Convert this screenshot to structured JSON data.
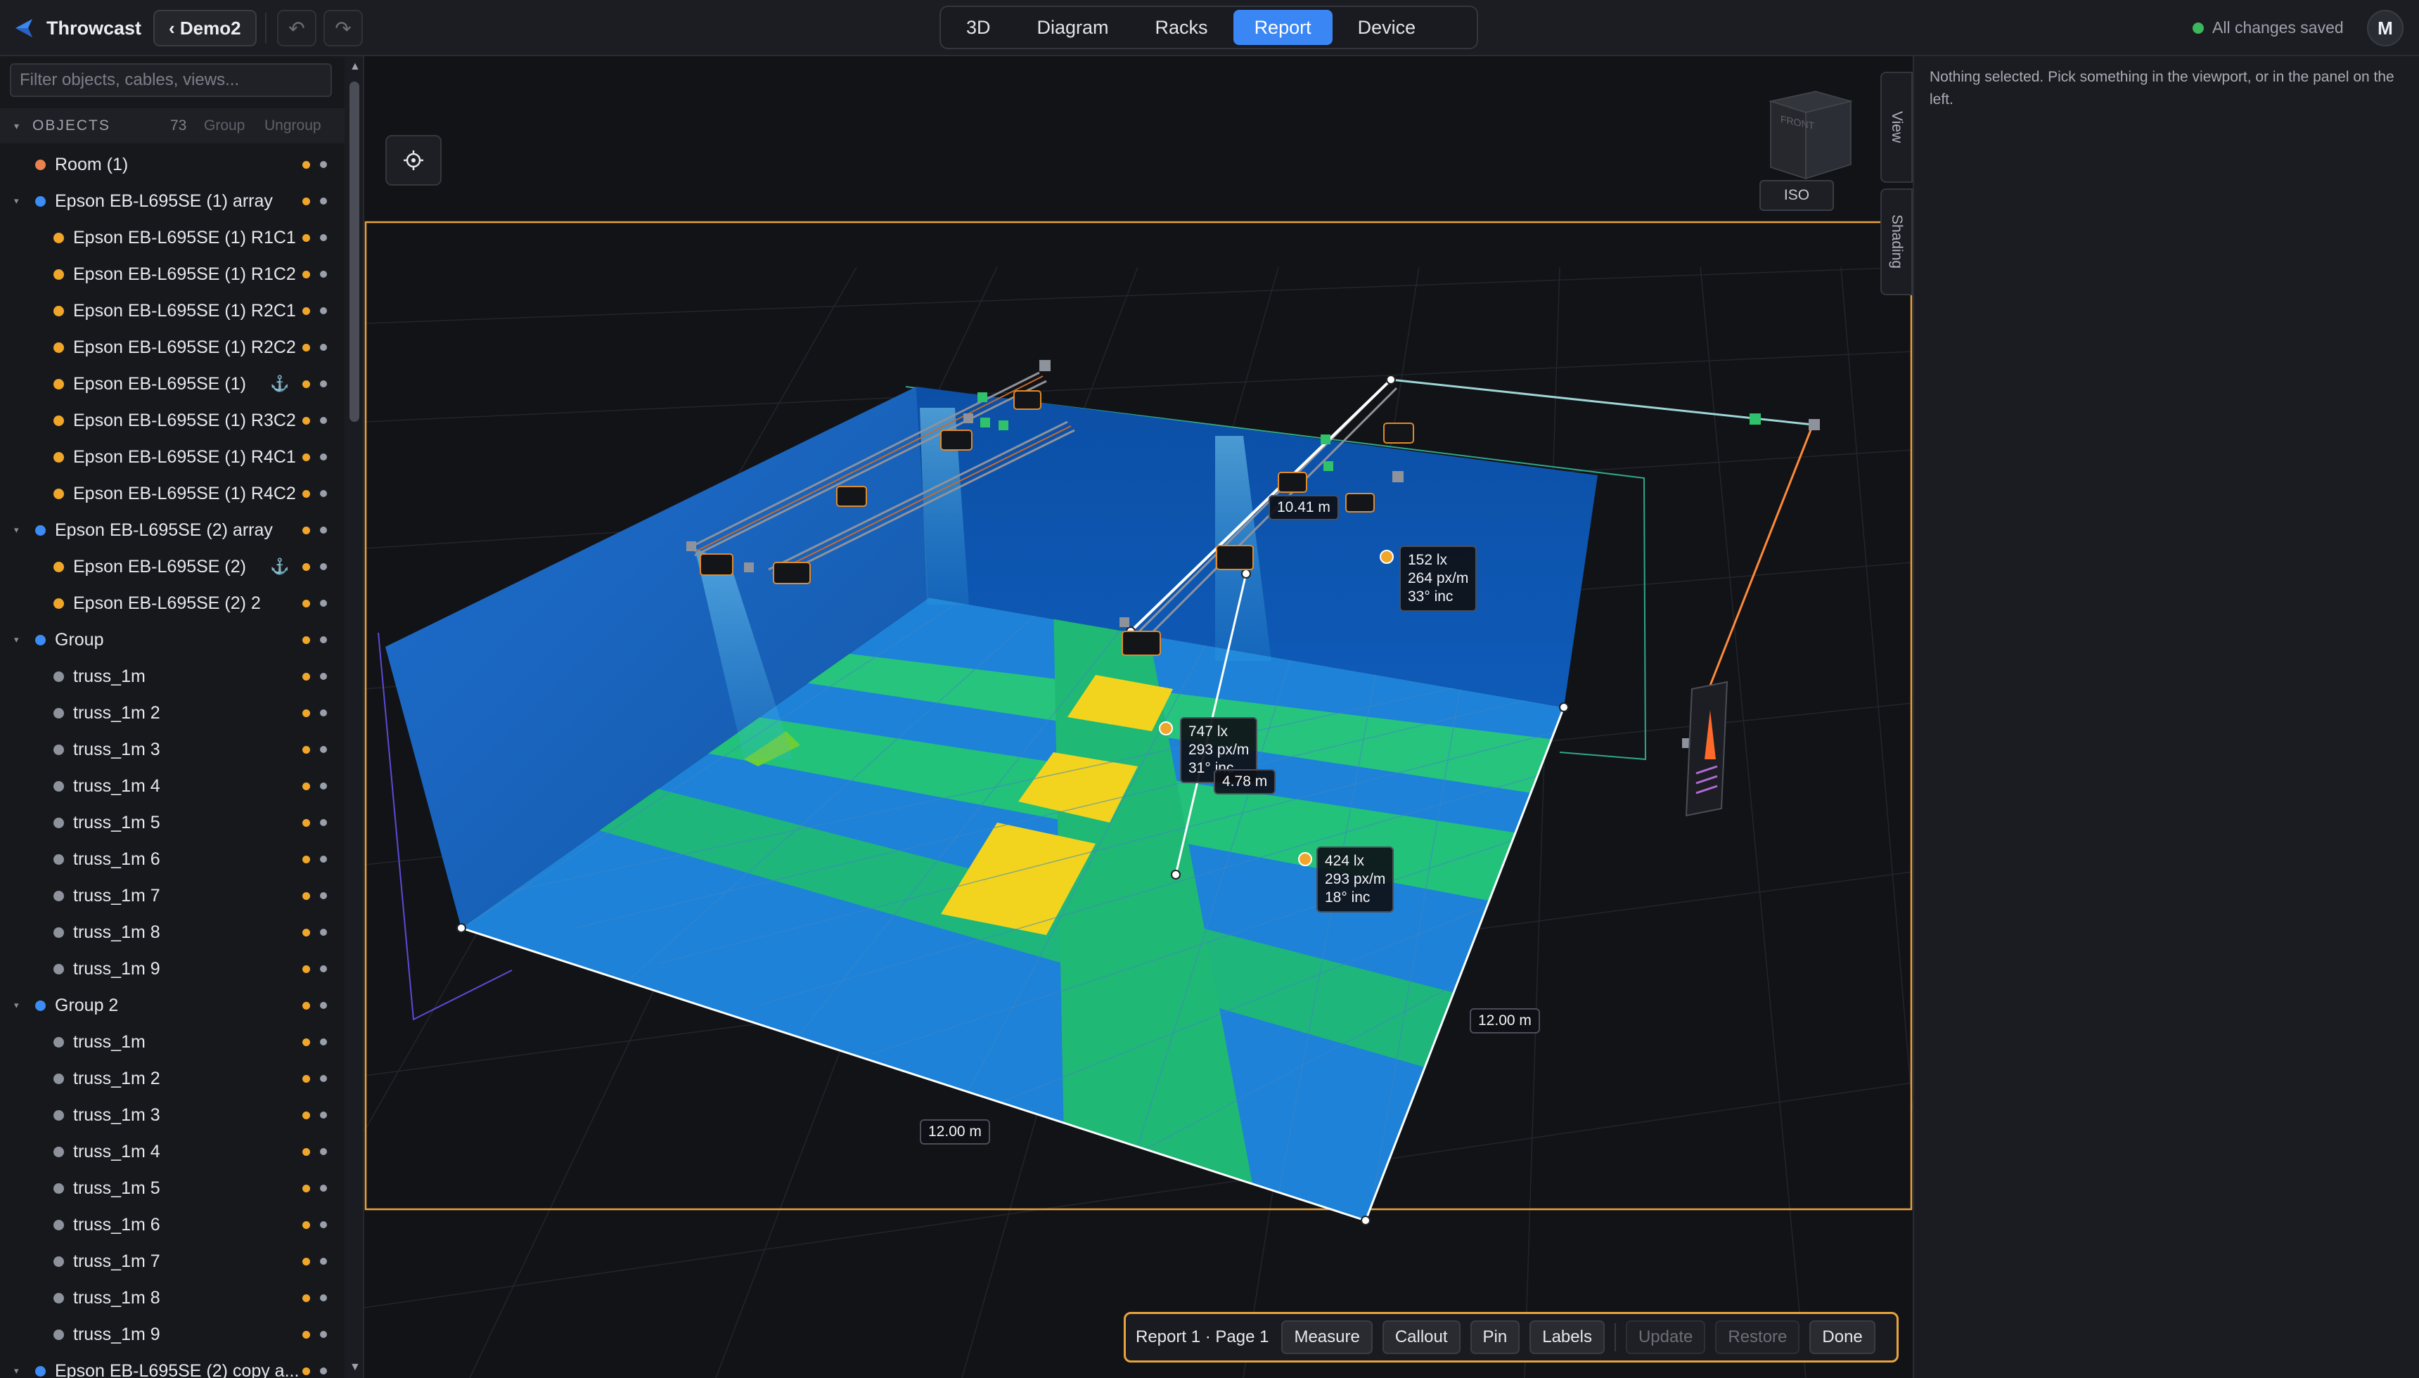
{
  "app": {
    "name": "Throwcast",
    "project": "‹ Demo2",
    "undo_glyph": "↶",
    "redo_glyph": "↷",
    "save_status": "All changes saved",
    "avatar_initial": "M",
    "accent": "#3a86f4"
  },
  "tabs": [
    {
      "label": "3D"
    },
    {
      "label": "Diagram"
    },
    {
      "label": "Racks"
    },
    {
      "label": "Report"
    },
    {
      "label": "Device"
    }
  ],
  "left_panel": {
    "filter_placeholder": "Filter objects, cables, views...",
    "objects_title": "OBJECTS",
    "objects_count": "73",
    "group_label": "Group",
    "ungroup_label": "Ungroup",
    "items": [
      {
        "label": "Room (1)",
        "level": 0,
        "expandable": false,
        "dot": "#e8834f",
        "anchor": false
      },
      {
        "label": "Epson EB-L695SE (1) array",
        "level": 0,
        "expandable": true,
        "dot": "#3b8cf5",
        "anchor": false
      },
      {
        "label": "Epson EB-L695SE (1) R1C1",
        "level": 1,
        "expandable": false,
        "dot": "#f0a62a",
        "anchor": false
      },
      {
        "label": "Epson EB-L695SE (1) R1C2",
        "level": 1,
        "expandable": false,
        "dot": "#f0a62a",
        "anchor": false
      },
      {
        "label": "Epson EB-L695SE (1) R2C1",
        "level": 1,
        "expandable": false,
        "dot": "#f0a62a",
        "anchor": false
      },
      {
        "label": "Epson EB-L695SE (1) R2C2",
        "level": 1,
        "expandable": false,
        "dot": "#f0a62a",
        "anchor": false
      },
      {
        "label": "Epson EB-L695SE (1)",
        "level": 1,
        "expandable": false,
        "dot": "#f0a62a",
        "anchor": true
      },
      {
        "label": "Epson EB-L695SE (1) R3C2",
        "level": 1,
        "expandable": false,
        "dot": "#f0a62a",
        "anchor": false
      },
      {
        "label": "Epson EB-L695SE (1) R4C1",
        "level": 1,
        "expandable": false,
        "dot": "#f0a62a",
        "anchor": false
      },
      {
        "label": "Epson EB-L695SE (1) R4C2",
        "level": 1,
        "expandable": false,
        "dot": "#f0a62a",
        "anchor": false
      },
      {
        "label": "Epson EB-L695SE (2) array",
        "level": 0,
        "expandable": true,
        "dot": "#3b8cf5",
        "anchor": false
      },
      {
        "label": "Epson EB-L695SE (2)",
        "level": 1,
        "expandable": false,
        "dot": "#f0a62a",
        "anchor": true
      },
      {
        "label": "Epson EB-L695SE (2) 2",
        "level": 1,
        "expandable": false,
        "dot": "#f0a62a",
        "anchor": false
      },
      {
        "label": "Group",
        "level": 0,
        "expandable": true,
        "dot": "#3b8cf5",
        "anchor": false
      },
      {
        "label": "truss_1m",
        "level": 1,
        "expandable": false,
        "dot": "#8d929c",
        "anchor": false
      },
      {
        "label": "truss_1m 2",
        "level": 1,
        "expandable": false,
        "dot": "#8d929c",
        "anchor": false
      },
      {
        "label": "truss_1m 3",
        "level": 1,
        "expandable": false,
        "dot": "#8d929c",
        "anchor": false
      },
      {
        "label": "truss_1m 4",
        "level": 1,
        "expandable": false,
        "dot": "#8d929c",
        "anchor": false
      },
      {
        "label": "truss_1m 5",
        "level": 1,
        "expandable": false,
        "dot": "#8d929c",
        "anchor": false
      },
      {
        "label": "truss_1m 6",
        "level": 1,
        "expandable": false,
        "dot": "#8d929c",
        "anchor": false
      },
      {
        "label": "truss_1m 7",
        "level": 1,
        "expandable": false,
        "dot": "#8d929c",
        "anchor": false
      },
      {
        "label": "truss_1m 8",
        "level": 1,
        "expandable": false,
        "dot": "#8d929c",
        "anchor": false
      },
      {
        "label": "truss_1m 9",
        "level": 1,
        "expandable": false,
        "dot": "#8d929c",
        "anchor": false
      },
      {
        "label": "Group 2",
        "level": 0,
        "expandable": true,
        "dot": "#3b8cf5",
        "anchor": false
      },
      {
        "label": "truss_1m",
        "level": 1,
        "expandable": false,
        "dot": "#8d929c",
        "anchor": false
      },
      {
        "label": "truss_1m 2",
        "level": 1,
        "expandable": false,
        "dot": "#8d929c",
        "anchor": false
      },
      {
        "label": "truss_1m 3",
        "level": 1,
        "expandable": false,
        "dot": "#8d929c",
        "anchor": false
      },
      {
        "label": "truss_1m 4",
        "level": 1,
        "expandable": false,
        "dot": "#8d929c",
        "anchor": false
      },
      {
        "label": "truss_1m 5",
        "level": 1,
        "expandable": false,
        "dot": "#8d929c",
        "anchor": false
      },
      {
        "label": "truss_1m 6",
        "level": 1,
        "expandable": false,
        "dot": "#8d929c",
        "anchor": false
      },
      {
        "label": "truss_1m 7",
        "level": 1,
        "expandable": false,
        "dot": "#8d929c",
        "anchor": false
      },
      {
        "label": "truss_1m 8",
        "level": 1,
        "expandable": false,
        "dot": "#8d929c",
        "anchor": false
      },
      {
        "label": "truss_1m 9",
        "level": 1,
        "expandable": false,
        "dot": "#8d929c",
        "anchor": false
      },
      {
        "label": "Epson EB-L695SE (2) copy a...",
        "level": 0,
        "expandable": true,
        "dot": "#3b8cf5",
        "anchor": false
      }
    ]
  },
  "viewport": {
    "view_cube_face": "FRONT",
    "iso_label": "ISO",
    "view_tab": "View",
    "shading_tab": "Shading",
    "callouts": [
      {
        "lux": "152 lx",
        "density": "264 px/m",
        "incidence": "33° inc"
      },
      {
        "lux": "747 lx",
        "density": "293 px/m",
        "incidence": "31° inc"
      },
      {
        "lux": "424 lx",
        "density": "293 px/m",
        "incidence": "18° inc"
      }
    ],
    "dimensions": {
      "height": "10.41 m",
      "throw": "4.78 m",
      "depth": "12.00 m",
      "width": "12.00 m"
    }
  },
  "report_bar": {
    "title": "Report 1 · Page 1",
    "measure": "Measure",
    "callout": "Callout",
    "pin": "Pin",
    "labels": "Labels",
    "update": "Update",
    "restore": "Restore",
    "done": "Done",
    "border_color": "#e8a33c"
  },
  "inspector": {
    "empty_message": "Nothing selected. Pick something in the viewport, or in the panel on the left."
  }
}
